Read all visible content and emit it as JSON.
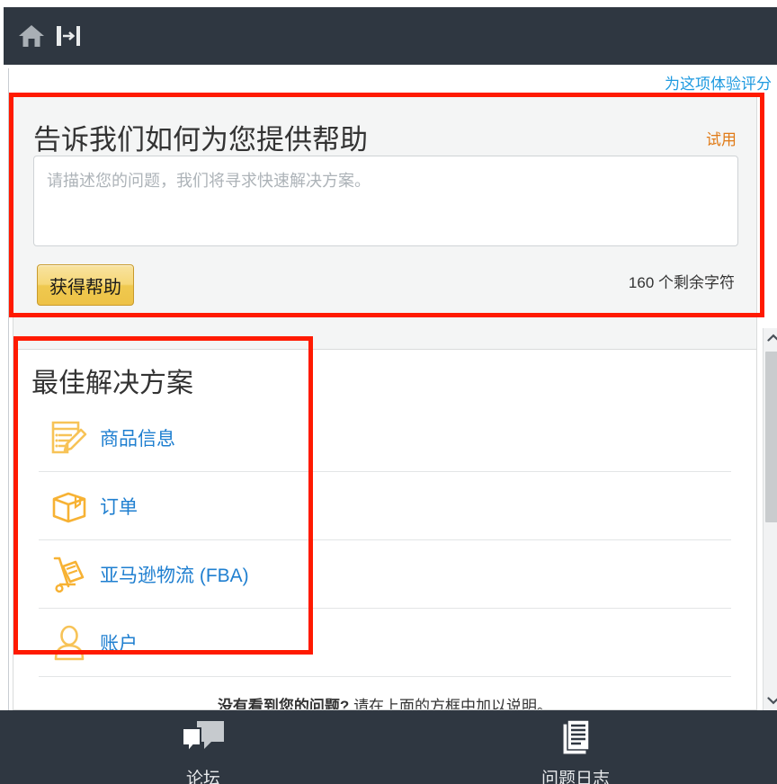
{
  "topbar": {
    "home_icon": "home-icon",
    "collapse_icon": "collapse-panel-icon"
  },
  "header": {
    "rate_link": "为这项体验评分"
  },
  "help_panel": {
    "title": "告诉我们如何为您提供帮助",
    "trial_label": "试用",
    "issue_placeholder": "请描述您的问题，我们将寻求快速解决方案。",
    "issue_value": "",
    "submit_label": "获得帮助",
    "chars_remaining": "160 个剩余字符"
  },
  "solutions_panel": {
    "title": "最佳解决方案",
    "items": [
      {
        "label": "商品信息",
        "icon": "listing-edit-icon"
      },
      {
        "label": "订单",
        "icon": "box-icon"
      },
      {
        "label": "亚马逊物流 (FBA)",
        "icon": "hand-truck-icon"
      },
      {
        "label": "账户",
        "icon": "person-icon"
      }
    ],
    "footer_bold": "没有看到您的问题?",
    "footer_rest": "请在上面的方框中加以说明。"
  },
  "scrollbar": {
    "up_arrow": "chevron-up-icon",
    "down_arrow": "chevron-down-icon"
  },
  "bottom_nav": [
    {
      "label": "论坛",
      "icon": "forum-icon"
    },
    {
      "label": "问题日志",
      "icon": "case-log-icon"
    }
  ],
  "colors": {
    "chrome": "#2f3741",
    "link": "#1f7fd0",
    "rate_link": "#1f9ae0",
    "trial": "#e07b18",
    "icon_orange": "#f5b33c",
    "button": "#f2d168",
    "annotation": "#ff1a00"
  }
}
